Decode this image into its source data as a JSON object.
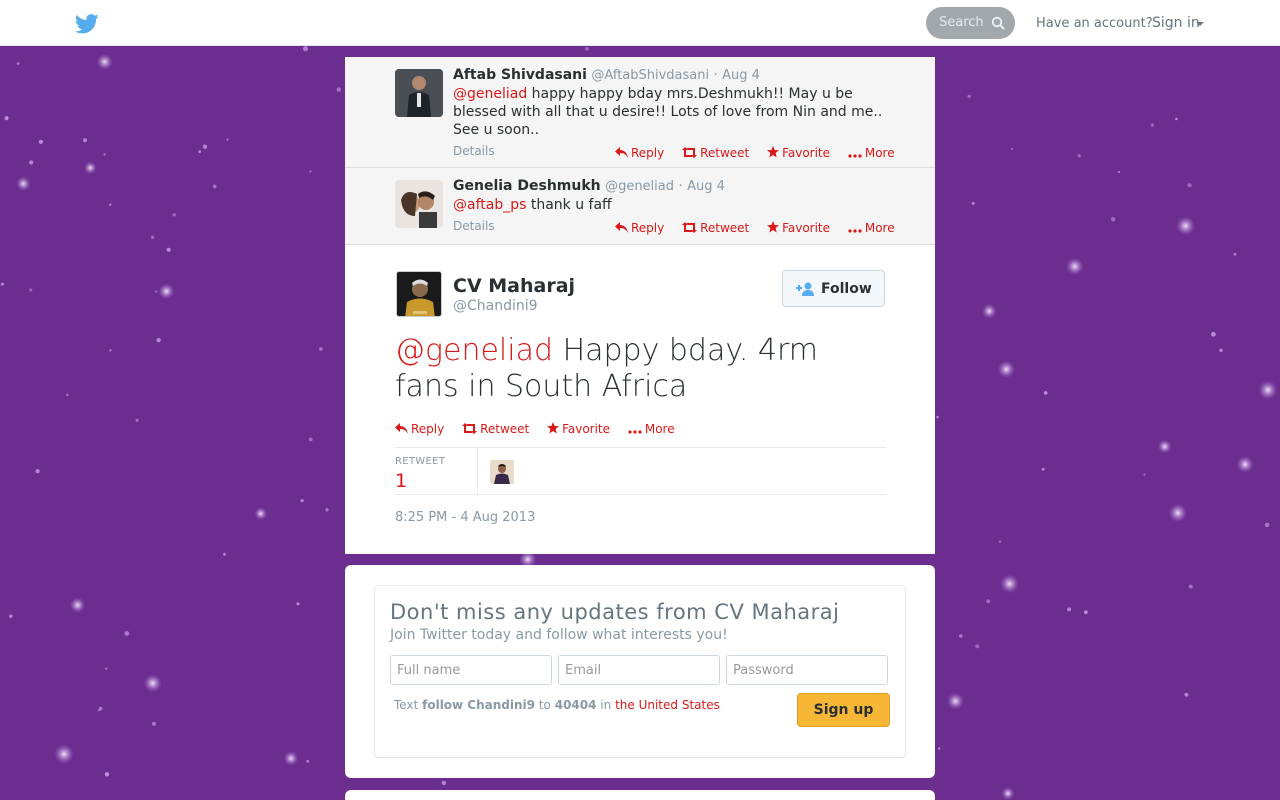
{
  "header": {
    "search_placeholder": "Search",
    "have_account": "Have an account?",
    "sign_in": "Sign in"
  },
  "conversation": [
    {
      "fullname": "Aftab Shivdasani",
      "screenname": "@AftabShivdasani",
      "time": "Aug 4",
      "mention": "@geneliad",
      "text": " happy happy bday mrs.Deshmukh!! May u be blessed with all that u desire!! Lots of love from Nin and me.. See u soon..",
      "details": "Details"
    },
    {
      "fullname": "Genelia Deshmukh",
      "screenname": "@geneliad",
      "time": "Aug 4",
      "mention": "@aftab_ps",
      "text": " thank u faff",
      "details": "Details"
    }
  ],
  "actions": {
    "reply": "Reply",
    "retweet": "Retweet",
    "favorite": "Favorite",
    "more": "More"
  },
  "main_tweet": {
    "fullname": "CV Maharaj",
    "screenname": "@Chandini9",
    "follow_label": "Follow",
    "mention": "@geneliad",
    "text": " Happy bday. 4rm fans in South Africa",
    "retweet_label": "RETWEET",
    "retweet_count": "1",
    "timestamp": "8:25 PM - 4 Aug 2013"
  },
  "signup": {
    "title": "Don't miss any updates from CV Maharaj",
    "subtitle": "Join Twitter today and follow what interests you!",
    "fullname_placeholder": "Full name",
    "email_placeholder": "Email",
    "password_placeholder": "Password",
    "sms_text": "Text",
    "sms_command": "follow Chandini9",
    "sms_to": "to",
    "sms_number": "40404",
    "sms_in": "in",
    "sms_country": "the United States",
    "button": "Sign up"
  },
  "colors": {
    "background": "#6b2e8f",
    "link": "#d81918",
    "twitter_blue": "#55acee",
    "signup_button": "#f8b637"
  },
  "icons": [
    "twitter-bird-icon",
    "search-icon",
    "reply-icon",
    "retweet-icon",
    "favorite-star-icon",
    "more-dots-icon",
    "follow-person-icon"
  ]
}
